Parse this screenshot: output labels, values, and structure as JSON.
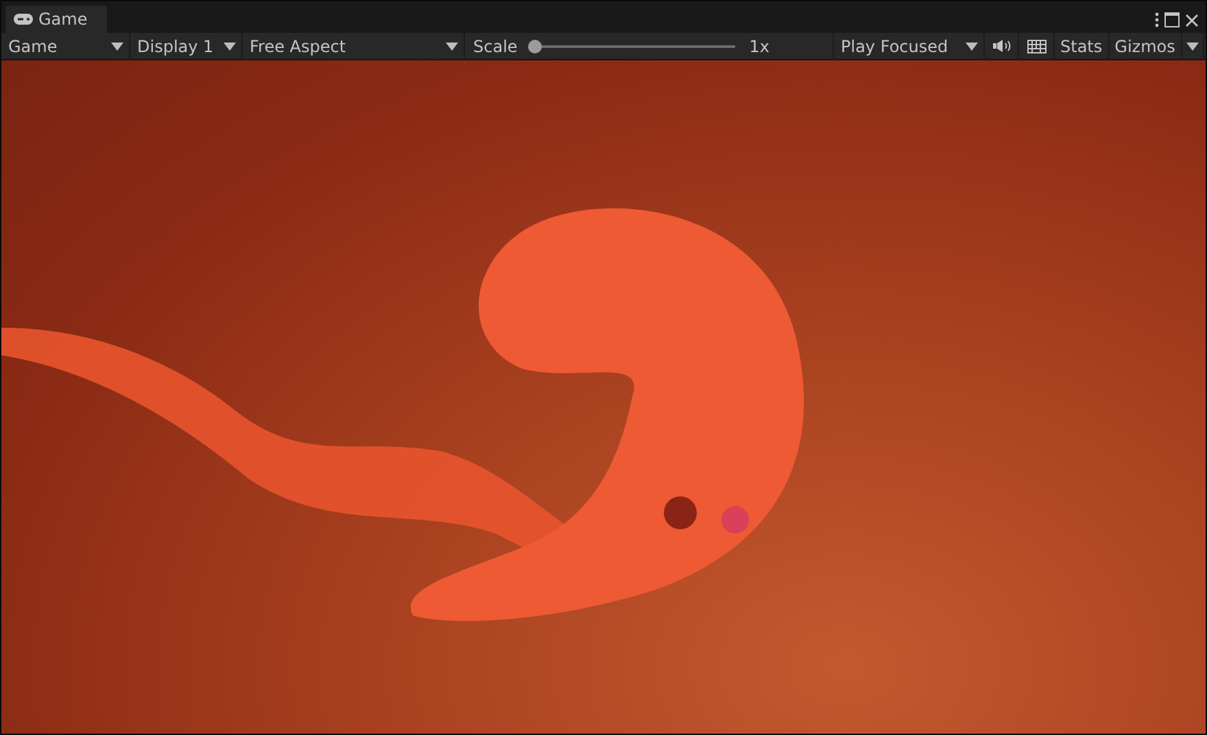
{
  "window": {
    "tab": "Game"
  },
  "toolbar": {
    "view_dropdown": "Game",
    "display_dropdown": "Display 1",
    "aspect_dropdown": "Free Aspect",
    "scale": {
      "label": "Scale",
      "level": 0,
      "reading": "1x"
    },
    "play_dropdown": "Play Focused",
    "stats": "Stats",
    "gizmos": "Gizmos"
  }
}
